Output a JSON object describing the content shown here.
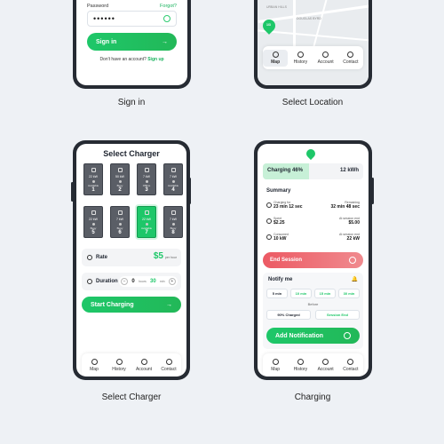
{
  "screens": {
    "sign_in": {
      "password_label": "Password",
      "forgot_label": "Forgot?",
      "password_value": "••••••",
      "sign_in_button": "Sign in",
      "no_account_text": "Don't have an account?",
      "sign_up_link": "Sign up",
      "caption": "Sign in"
    },
    "select_location": {
      "street_1": "URBAN HILLS",
      "street_2": "DOUGLAS BYRD",
      "pin_label": "1/3",
      "caption": "Select Location"
    },
    "select_charger": {
      "title": "Select Charger",
      "chargers": [
        {
          "kw": "22 kW",
          "status": "Available",
          "number": "1"
        },
        {
          "kw": "50 kW",
          "status": "Busy",
          "number": "2"
        },
        {
          "kw": "7 kW",
          "status": "Offline",
          "number": "3"
        },
        {
          "kw": "7 kW",
          "status": "Available",
          "number": "4"
        },
        {
          "kw": "22 kW",
          "status": "Busy",
          "number": "5"
        },
        {
          "kw": "7 kW",
          "status": "Busy",
          "number": "6"
        },
        {
          "kw": "22 kW",
          "status": "Available",
          "number": "7"
        },
        {
          "kw": "7 kW",
          "status": "Busy",
          "number": "8"
        }
      ],
      "selected_index": 6,
      "rate_label": "Rate",
      "rate_value": "$5",
      "rate_unit": "per hour",
      "duration_label": "Duration",
      "duration_hours": "0",
      "hours_label": "hours",
      "duration_minutes": "30",
      "minutes_label": "min",
      "start_button": "Start Charging",
      "caption": "Select Charger"
    },
    "charging": {
      "charge_percent_label": "Charging 46%",
      "charge_progress": 0.46,
      "energy": "12 kWh",
      "summary_title": "Summary",
      "charging_for_label": "Charging for",
      "charging_for_value": "23 min 12 sec",
      "remaining_label": "Remaining",
      "remaining_value": "32 min 48 sec",
      "spent_label": "Spent",
      "spent_value": "$2.25",
      "at_end_label": "At session end",
      "at_end_cost": "$5.00",
      "consumed_label": "Consumed",
      "consumed_value": "10 kW",
      "at_end_label_2": "At session end",
      "at_end_kw": "22 kW",
      "end_session_button": "End Session",
      "notify_title": "Notify me",
      "notify_options": [
        "5 min",
        "10 min",
        "15 min",
        "30 min"
      ],
      "before_label": "Before",
      "charged_option": "90% Charged",
      "session_end_option": "Session End",
      "add_notification_button": "Add Notification",
      "caption": "Charging"
    }
  },
  "tabs": [
    "Map",
    "History",
    "Account",
    "Contact"
  ],
  "colors": {
    "accent": "#1ec769",
    "danger": "#ec5a64",
    "phone": "#262b33"
  }
}
